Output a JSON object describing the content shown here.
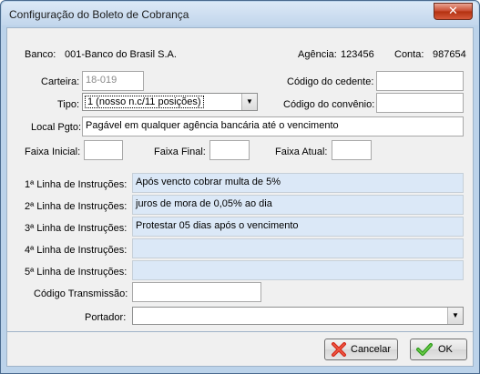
{
  "window": {
    "title": "Configuração do Boleto de Cobrança",
    "close_glyph": "✕"
  },
  "header": {
    "banco_label": "Banco:",
    "banco_value": "001-Banco do Brasil S.A.",
    "agencia_label": "Agência:",
    "agencia_value": "123456",
    "conta_label": "Conta:",
    "conta_value": "987654"
  },
  "form": {
    "carteira_label": "Carteira:",
    "carteira_value": "18-019",
    "codigo_cedente_label": "Código do cedente:",
    "codigo_cedente_value": "",
    "tipo_label": "Tipo:",
    "tipo_value": "1 (nosso n.c/11 posições)",
    "codigo_convenio_label": "Código do convênio:",
    "codigo_convenio_value": "",
    "local_pgto_label": "Local Pgto:",
    "local_pgto_value": "Pagável em qualquer agência bancária até o vencimento",
    "faixa_inicial_label": "Faixa Inicial:",
    "faixa_final_label": "Faixa Final:",
    "faixa_atual_label": "Faixa Atual:",
    "instrucoes": [
      {
        "label": "1ª Linha de Instruções:",
        "value": "Após vencto cobrar multa de 5%"
      },
      {
        "label": "2ª Linha de Instruções:",
        "value": "juros de mora de 0,05% ao dia"
      },
      {
        "label": "3ª Linha de Instruções:",
        "value": "Protestar 05 dias após o vencimento"
      },
      {
        "label": "4ª Linha de Instruções:",
        "value": ""
      },
      {
        "label": "5ª Linha de Instruções:",
        "value": ""
      }
    ],
    "codigo_transmissao_label": "Código Transmissão:",
    "portador_label": "Portador:",
    "portador_value": ""
  },
  "buttons": {
    "cancel_label": "Cancelar",
    "ok_label": "OK"
  },
  "icons": {
    "close": "close-icon",
    "cancel": "red-x-icon",
    "ok": "green-check-icon",
    "dropdown": "chevron-down-icon"
  }
}
